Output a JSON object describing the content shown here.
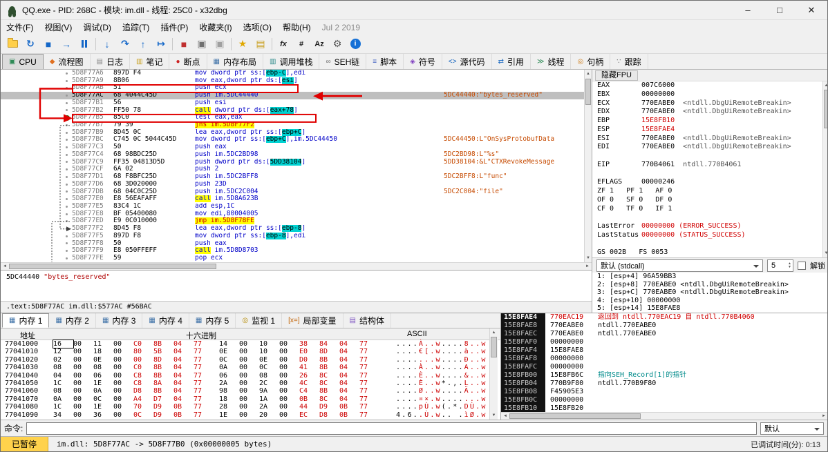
{
  "window": {
    "title": "QQ.exe - PID: 268C - 模块: im.dll - 线程: 25C0 - x32dbg",
    "min": "–",
    "max": "□",
    "close": "✕"
  },
  "menu": {
    "items": [
      "文件(F)",
      "视图(V)",
      "调试(D)",
      "追踪(T)",
      "插件(P)",
      "收藏夹(I)",
      "选项(O)",
      "帮助(H)"
    ],
    "date": "Jul 2 2019"
  },
  "toolbar": [
    {
      "name": "open-file",
      "kind": "folder"
    },
    {
      "name": "restart",
      "kind": "glyph",
      "glyph": "↻",
      "color": "#1467c8"
    },
    {
      "name": "stop",
      "kind": "glyph",
      "glyph": "■",
      "color": "#1467c8"
    },
    {
      "name": "run",
      "kind": "glyph",
      "glyph": "→",
      "color": "#1467c8"
    },
    {
      "name": "pause",
      "kind": "pause"
    },
    {
      "kind": "sep"
    },
    {
      "name": "step-into",
      "kind": "glyph",
      "glyph": "↓",
      "color": "#1467c8"
    },
    {
      "name": "step-over",
      "kind": "glyph",
      "glyph": "↷",
      "color": "#1467c8"
    },
    {
      "name": "step-out",
      "kind": "glyph",
      "glyph": "↑",
      "color": "#1467c8"
    },
    {
      "name": "run-to-cursor",
      "kind": "glyph",
      "glyph": "↦",
      "color": "#1467c8"
    },
    {
      "kind": "sep"
    },
    {
      "name": "breakpoints",
      "kind": "glyph",
      "glyph": "■",
      "color": "#c03030"
    },
    {
      "name": "trace-into",
      "kind": "glyph",
      "glyph": "▣",
      "color": "#707070"
    },
    {
      "name": "trace-over",
      "kind": "glyph",
      "glyph": "▣",
      "color": "#a0a0a0"
    },
    {
      "kind": "sep"
    },
    {
      "name": "favourites",
      "kind": "glyph",
      "glyph": "★",
      "color": "#e0a800"
    },
    {
      "name": "notes",
      "kind": "glyph",
      "glyph": "▤",
      "color": "#c8a020"
    },
    {
      "kind": "sep"
    },
    {
      "name": "assemble",
      "kind": "text",
      "glyph": "fx",
      "italic": true,
      "color": "#222222"
    },
    {
      "name": "patch",
      "kind": "text",
      "glyph": "#",
      "color": "#222222"
    },
    {
      "name": "strings",
      "kind": "text",
      "glyph": "Az",
      "color": "#222222"
    },
    {
      "name": "settings",
      "kind": "glyph",
      "glyph": "⚙",
      "color": "#555555"
    },
    {
      "name": "help",
      "kind": "info",
      "glyph": "i"
    }
  ],
  "main_tabs": [
    {
      "id": "cpu",
      "label": "CPU",
      "glyph": "▣",
      "color": "#2e8b57",
      "active": true
    },
    {
      "id": "graph",
      "label": "流程图",
      "glyph": "◆",
      "color": "#e07020"
    },
    {
      "id": "log",
      "label": "日志",
      "glyph": "▤",
      "color": "#888888"
    },
    {
      "id": "notes",
      "label": "笔记",
      "glyph": "▥",
      "color": "#c8a020"
    },
    {
      "id": "breakpoints",
      "label": "断点",
      "glyph": "●",
      "color": "#cc2020"
    },
    {
      "id": "memory-map",
      "label": "内存布局",
      "glyph": "▦",
      "color": "#3a6ea5"
    },
    {
      "id": "call-stack",
      "label": "调用堆栈",
      "glyph": "▥",
      "color": "#2e8b8b"
    },
    {
      "id": "seh",
      "label": "SEH链",
      "glyph": "∞",
      "color": "#707070"
    },
    {
      "id": "script",
      "label": "脚本",
      "glyph": "≡",
      "color": "#4060c0"
    },
    {
      "id": "symbols",
      "label": "符号",
      "glyph": "◈",
      "color": "#8040c0"
    },
    {
      "id": "source",
      "label": "源代码",
      "glyph": "<>",
      "color": "#1565c0"
    },
    {
      "id": "references",
      "label": "引用",
      "glyph": "⇄",
      "color": "#1565c0"
    },
    {
      "id": "threads",
      "label": "线程",
      "glyph": "≫",
      "color": "#2e8b57"
    },
    {
      "id": "handles",
      "label": "句柄",
      "glyph": "◎",
      "color": "#d08020"
    },
    {
      "id": "trace",
      "label": "跟踪",
      "glyph": "∵",
      "color": "#707070"
    }
  ],
  "disasm": {
    "rows": [
      {
        "addr": "5D8F77A6",
        "bytes": "897D F4",
        "instr": [
          [
            "mov dword ptr ss:[",
            "i"
          ],
          [
            "ebp-C",
            "cy"
          ],
          [
            "],edi",
            "i"
          ]
        ]
      },
      {
        "addr": "5D8F77A9",
        "bytes": "8B06",
        "instr": [
          [
            "mov eax,dword ptr ds:[",
            "i"
          ],
          [
            "esi",
            "cy"
          ],
          [
            "]",
            "i"
          ]
        ]
      },
      {
        "addr": "5D8F77AB",
        "bytes": "51",
        "instr": [
          [
            "push ecx",
            "i"
          ]
        ]
      },
      {
        "addr": "5D8F77AC",
        "bytes": "68 4044C45D",
        "instr": [
          [
            "push im.5DC44440",
            "i"
          ]
        ],
        "comment": "5DC44440:\"bytes_reserved\"",
        "selected": true
      },
      {
        "addr": "5D8F77B1",
        "bytes": "56",
        "instr": [
          [
            "push esi",
            "i"
          ]
        ]
      },
      {
        "addr": "5D8F77B2",
        "bytes": "FF50 78",
        "instr": [
          [
            "call",
            "c"
          ],
          [
            " dword ptr ds:[",
            "i"
          ],
          [
            "eax+78",
            "cy"
          ],
          [
            "]",
            "i"
          ]
        ]
      },
      {
        "addr": "5D8F77B5",
        "bytes": "85C0",
        "instr": [
          [
            "test eax,eax",
            "i"
          ]
        ],
        "bp": true
      },
      {
        "addr": "5D8F77B7",
        "bytes": "79 39",
        "instr": [
          [
            "jns im.5D8F77F2",
            "j"
          ]
        ]
      },
      {
        "addr": "5D8F77B9",
        "bytes": "8D45 0C",
        "instr": [
          [
            "lea eax,dword ptr ss:[",
            "i"
          ],
          [
            "ebp+C",
            "cy"
          ],
          [
            "]",
            "i"
          ]
        ]
      },
      {
        "addr": "5D8F77BC",
        "bytes": "C745 0C 5044C45D",
        "instr": [
          [
            "mov dword ptr ss:[",
            "i"
          ],
          [
            "ebp+C",
            "cy"
          ],
          [
            "],im.5DC44450",
            "i"
          ]
        ],
        "comment": "5DC44450:L\"OnSysProtobufData"
      },
      {
        "addr": "5D8F77C3",
        "bytes": "50",
        "instr": [
          [
            "push eax",
            "i"
          ]
        ]
      },
      {
        "addr": "5D8F77C4",
        "bytes": "68 98BDC25D",
        "instr": [
          [
            "push im.5DC2BD98",
            "i"
          ]
        ],
        "comment": "5DC2BD98:L\"%s\""
      },
      {
        "addr": "5D8F77C9",
        "bytes": "FF35 04813D5D",
        "instr": [
          [
            "push dword ptr ds:[",
            "i"
          ],
          [
            "5DD38104",
            "cy"
          ],
          [
            "]",
            "i"
          ]
        ],
        "comment": "5DD38104:&L\"CTXRevokeMessage"
      },
      {
        "addr": "5D8F77CF",
        "bytes": "6A 02",
        "instr": [
          [
            "push 2",
            "i"
          ]
        ]
      },
      {
        "addr": "5D8F77D1",
        "bytes": "68 F8BFC25D",
        "instr": [
          [
            "push im.5DC2BFF8",
            "i"
          ]
        ],
        "comment": "5DC2BFF8:L\"func\""
      },
      {
        "addr": "5D8F77D6",
        "bytes": "68 3D020000",
        "instr": [
          [
            "push 23D",
            "i"
          ]
        ]
      },
      {
        "addr": "5D8F77DB",
        "bytes": "68 04C0C25D",
        "instr": [
          [
            "push im.5DC2C004",
            "i"
          ]
        ],
        "comment": "5DC2C004:\"file\""
      },
      {
        "addr": "5D8F77E0",
        "bytes": "E8 56EAFAFF",
        "instr": [
          [
            "call",
            "c"
          ],
          [
            " im.5D8A623B",
            "i"
          ]
        ]
      },
      {
        "addr": "5D8F77E5",
        "bytes": "83C4 1C",
        "instr": [
          [
            "add esp,1C",
            "i"
          ]
        ]
      },
      {
        "addr": "5D8F77E8",
        "bytes": "BF 05400080",
        "instr": [
          [
            "mov edi,80004005",
            "i"
          ]
        ]
      },
      {
        "addr": "5D8F77ED",
        "bytes": "E9 0C010000",
        "instr": [
          [
            "jmp im.5D8F78FE",
            "j"
          ]
        ]
      },
      {
        "addr": "5D8F77F2",
        "bytes": "8D45 F8",
        "instr": [
          [
            "lea eax,dword ptr ss:[",
            "i"
          ],
          [
            "ebp-8",
            "cy"
          ],
          [
            "]",
            "i"
          ]
        ]
      },
      {
        "addr": "5D8F77F5",
        "bytes": "897D F8",
        "instr": [
          [
            "mov dword ptr ss:[",
            "i"
          ],
          [
            "ebp-8",
            "cy"
          ],
          [
            "],edi",
            "i"
          ]
        ]
      },
      {
        "addr": "5D8F77F8",
        "bytes": "50",
        "instr": [
          [
            "push eax",
            "i"
          ]
        ]
      },
      {
        "addr": "5D8F77F9",
        "bytes": "E8 050FFEFF",
        "instr": [
          [
            "call",
            "c"
          ],
          [
            " im.5D8D8703",
            "i"
          ]
        ]
      },
      {
        "addr": "5D8F77FE",
        "bytes": "59",
        "instr": [
          [
            "pop ecx",
            "i"
          ]
        ]
      }
    ]
  },
  "info_pane": {
    "address": "5DC44440",
    "string": "\"bytes_reserved\"",
    "status": ".text:5D8F77AC im.dll:$577AC #56BAC"
  },
  "registers": {
    "header": "隐藏FPU",
    "rows": [
      {
        "n": "EAX",
        "v": "007C6000"
      },
      {
        "n": "EBX",
        "v": "00000000"
      },
      {
        "n": "ECX",
        "v": "770EABE0",
        "a": "<ntdll.DbgUiRemoteBreakin>"
      },
      {
        "n": "EDX",
        "v": "770EABE0",
        "a": "<ntdll.DbgUiRemoteBreakin>"
      },
      {
        "n": "EBP",
        "v": "15E8FB10",
        "red": true
      },
      {
        "n": "ESP",
        "v": "15E8FAE4",
        "red": true
      },
      {
        "n": "ESI",
        "v": "770EABE0",
        "a": "<ntdll.DbgUiRemoteBreakin>"
      },
      {
        "n": "EDI",
        "v": "770EABE0",
        "a": "<ntdll.DbgUiRemoteBreakin>"
      },
      {
        "sp": true
      },
      {
        "n": "EIP",
        "v": "770B4061",
        "a": "ntdll.770B4061"
      },
      {
        "sp": true
      },
      {
        "n": "EFLAGS",
        "v": "00000246"
      },
      {
        "text": "ZF 1   PF 1   AF 0"
      },
      {
        "text": "OF 0   SF 0   DF 0"
      },
      {
        "text": "CF 0   TF 0   IF 1"
      },
      {
        "sp": true
      },
      {
        "n": "LastError",
        "v": "00000000 (ERROR_SUCCESS)",
        "red": true
      },
      {
        "n": "LastStatus",
        "v": "00000000 (STATUS_SUCCESS)",
        "red": true
      },
      {
        "sp": true
      },
      {
        "text": "GS 002B   FS 0053"
      }
    ],
    "calling_convention": "默认 (stdcall)",
    "depth": "5",
    "unlock_label": "解锁",
    "args": [
      "1: [esp+4] 96A59BB3",
      "2: [esp+8] 770EABE0 <ntdll.DbgUiRemoteBreakin>",
      "3: [esp+C] 770EABE0 <ntdll.DbgUiRemoteBreakin>",
      "4: [esp+10] 00000000",
      "5: [esp+14] 15E8FAE8"
    ]
  },
  "bottom_tabs": [
    {
      "id": "memory-1",
      "label": "内存 1",
      "glyph": "▦",
      "color": "#3a6ea5",
      "active": true
    },
    {
      "id": "memory-2",
      "label": "内存 2",
      "glyph": "▦",
      "color": "#3a6ea5"
    },
    {
      "id": "memory-3",
      "label": "内存 3",
      "glyph": "▦",
      "color": "#3a6ea5"
    },
    {
      "id": "memory-4",
      "label": "内存 4",
      "glyph": "▦",
      "color": "#3a6ea5"
    },
    {
      "id": "memory-5",
      "label": "内存 5",
      "glyph": "▦",
      "color": "#3a6ea5"
    },
    {
      "id": "watch-1",
      "label": "监视 1",
      "glyph": "◎",
      "color": "#b58a00"
    },
    {
      "id": "locals",
      "label": "局部变量",
      "glyph": "[x=]",
      "color": "#c06000"
    },
    {
      "id": "struct",
      "label": "结构体",
      "glyph": "▤",
      "color": "#7a4fbf"
    }
  ],
  "memory": {
    "headers": {
      "addr": "地址",
      "hex": "十六进制",
      "ascii": "ASCII"
    },
    "rows": [
      {
        "addr": "77041000",
        "hex": [
          "16 00 11 00",
          "C0 8B 04 77",
          "14 00 10 00",
          "38 84 04 77"
        ],
        "ascii": [
          "....",
          "À..w",
          "....",
          "8..w"
        ]
      },
      {
        "addr": "77041010",
        "hex": [
          "12 00 18 00",
          "80 5B 04 77",
          "0E 00 10 00",
          "E0 8D 04 77"
        ],
        "ascii": [
          "....",
          "€[.w",
          "....",
          "à..w"
        ]
      },
      {
        "addr": "77041020",
        "hex": [
          "02 00 0E 00",
          "00 8D 04 77",
          "0C 00 0E 00",
          "D0 8B 04 77"
        ],
        "ascii": [
          "....",
          "...w",
          "....",
          "Ð..w"
        ]
      },
      {
        "addr": "77041030",
        "hex": [
          "08 00 08 00",
          "C0 8B 04 77",
          "0A 00 0C 00",
          "41 8B 04 77"
        ],
        "ascii": [
          "....",
          "À..w",
          "....",
          "A..w"
        ]
      },
      {
        "addr": "77041040",
        "hex": [
          "04 00 06 00",
          "C8 8B 04 77",
          "06 00 08 00",
          "26 8C 04 77"
        ],
        "ascii": [
          "....",
          "È..w",
          "....",
          "&..w"
        ]
      },
      {
        "addr": "77041050",
        "hex": [
          "1C 00 1E 00",
          "C8 8A 04 77",
          "2A 00 2C 00",
          "4C 8C 04 77"
        ],
        "ascii": [
          "....",
          "È..w",
          "*.,.",
          "L..w"
        ]
      },
      {
        "addr": "77041060",
        "hex": [
          "08 00 0A 00",
          "D8 8B 04 77",
          "98 00 9A 00",
          "C4 8B 04 77"
        ],
        "ascii": [
          "....",
          "Ø..w",
          "....",
          "Ä..w"
        ]
      },
      {
        "addr": "77041070",
        "hex": [
          "0A 00 0C 00",
          "A4 D7 04 77",
          "18 00 1A 00",
          "0B 8C 04 77"
        ],
        "ascii": [
          "....",
          "¤×.w",
          "....",
          "...w"
        ]
      },
      {
        "addr": "77041080",
        "hex": [
          "1C 00 1E 00",
          "70 D9 0B 77",
          "28 00 2A 00",
          "44 D9 0B 77"
        ],
        "ascii": [
          "....",
          "pÙ.w",
          "(.*.",
          "DÙ.w"
        ]
      },
      {
        "addr": "77041090",
        "hex": [
          "34 00 36 00",
          "0C D9 0B 77",
          "1E 00 20 00",
          "EC D8 0B 77"
        ],
        "ascii": [
          "4.6.",
          ".Ù.w",
          ".. .",
          "ìØ.w"
        ]
      }
    ]
  },
  "stack": {
    "rows": [
      {
        "addr": "15E8FAE4",
        "value": "770EAC19",
        "vc": "red",
        "comment": "返回到 ntdll.770EAC19 自 ntdll.770B4060",
        "cc": "red"
      },
      {
        "addr": "15E8FAE8",
        "value": "770EABE0",
        "comment": "ntdll.770EABE0"
      },
      {
        "addr": "15E8FAEC",
        "value": "770EABE0",
        "comment": "ntdll.770EABE0"
      },
      {
        "addr": "15E8FAF0",
        "value": "00000000"
      },
      {
        "addr": "15E8FAF4",
        "value": "15E8FAE8"
      },
      {
        "addr": "15E8FAF8",
        "value": "00000000"
      },
      {
        "addr": "15E8FAFC",
        "value": "00000000"
      },
      {
        "addr": "15E8FB00",
        "value": "15E8FB6C",
        "comment": "指向SEH_Record[1]的指针",
        "cc": "teal"
      },
      {
        "addr": "15E8FB04",
        "value": "770B9F80",
        "comment": "ntdll.770B9F80"
      },
      {
        "addr": "15E8FB08",
        "value": "F45905E3"
      },
      {
        "addr": "15E8FB0C",
        "value": "00000000"
      },
      {
        "addr": "15E8FB10",
        "value": "15E8FB20"
      }
    ]
  },
  "command": {
    "label": "命令:",
    "value": "",
    "combo": "默认"
  },
  "status": {
    "state": "已暂停",
    "message": "im.dll: 5D8F77AC -> 5D8F77B0 (0x00000005 bytes)",
    "time": "已调试时间(分): 0:13"
  }
}
